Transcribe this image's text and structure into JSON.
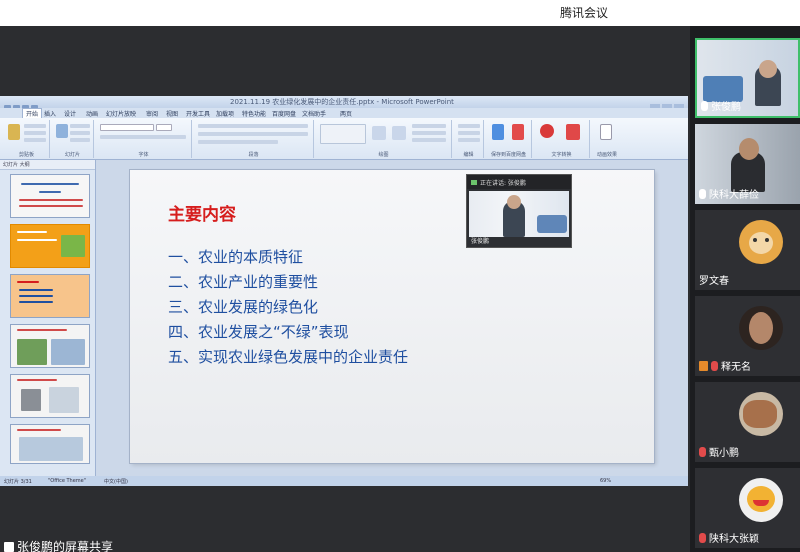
{
  "app": {
    "title": "腾讯会议"
  },
  "ppt": {
    "window_title": "2021.11.19 农业绿化发展中的企业责任.pptx - Microsoft PowerPoint",
    "tabs": [
      "开始",
      "插入",
      "设计",
      "动画",
      "幻灯片放映",
      "审阅",
      "视图",
      "开发工具",
      "加载项",
      "特色功能",
      "百度网盘",
      "文档助手",
      "两页"
    ],
    "groups": [
      "剪贴板",
      "幻灯片",
      "字体",
      "段落",
      "绘图",
      "编辑",
      "保存到百度网盘",
      "文字转换",
      "动画效果"
    ],
    "panel_tabs": "幻灯片  大纲",
    "status": {
      "slide": "幻灯片 3/31",
      "theme": "\"Office Theme\"",
      "lang": "中文(中国)",
      "zoom": "69%"
    }
  },
  "slide": {
    "title": "主要内容",
    "items": [
      "一、农业的本质特征",
      "二、农业产业的重要性",
      "三、农业发展的绿色化",
      "四、农业发展之“不绿”表现",
      "五、实现农业绿色发展中的企业责任"
    ]
  },
  "floating_video": {
    "header": "正在讲话: 张俊鹏",
    "name": "张俊鹏"
  },
  "share_caption": "张俊鹏的屏幕共享",
  "participants": [
    {
      "name": "张俊鹏",
      "muted": false
    },
    {
      "name": "陕科大薛俭",
      "muted": false
    },
    {
      "name": "罗文春",
      "muted": false
    },
    {
      "name": "释无名",
      "muted": true
    },
    {
      "name": "甄小鹏",
      "muted": true
    },
    {
      "name": "陕科大张颖",
      "muted": true
    }
  ],
  "colors": {
    "title_red": "#d61d1d",
    "item_blue": "#1f4fa0",
    "active_speaker": "#3fbf6a"
  }
}
